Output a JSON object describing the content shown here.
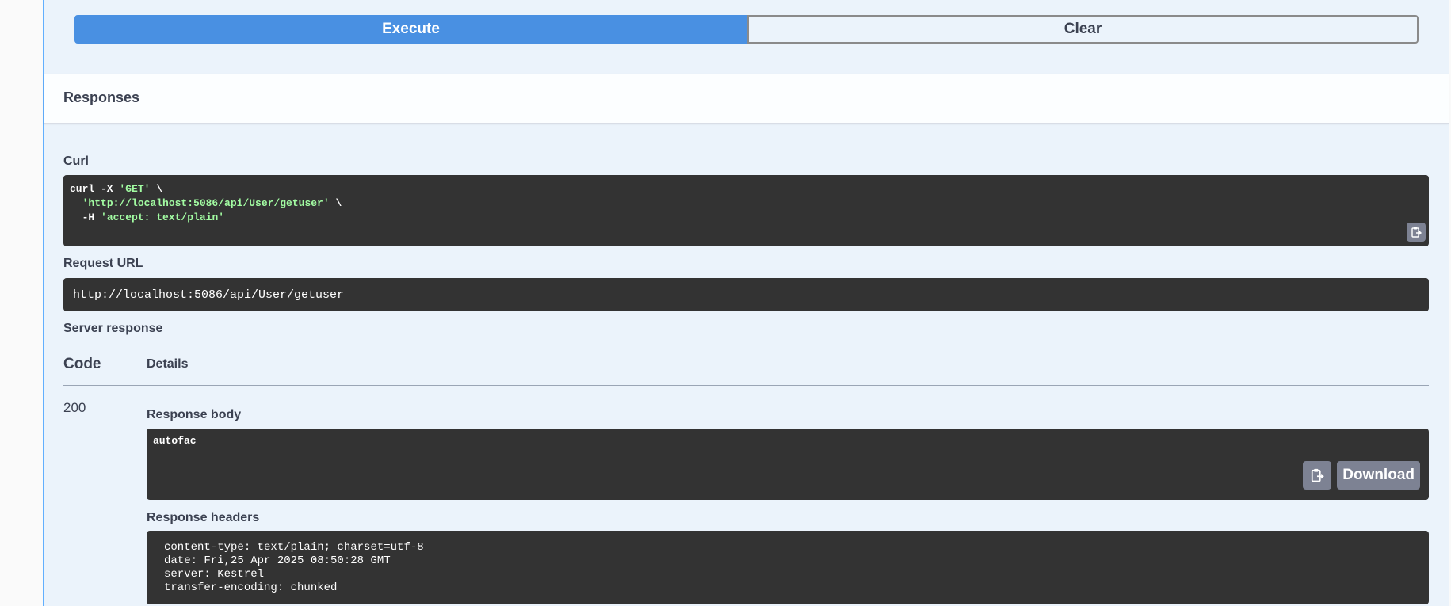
{
  "buttons": {
    "execute": "Execute",
    "clear": "Clear"
  },
  "responses": {
    "title": "Responses",
    "curl_label": "Curl",
    "curl": {
      "line1_cmd": "curl -X ",
      "line1_method": "'GET'",
      "line1_end": " \\",
      "line2_url": "'http://localhost:5086/api/User/getuser'",
      "line2_end": " \\",
      "line3_flag": "  -H ",
      "line3_header": "'accept: text/plain'"
    },
    "request_url_label": "Request URL",
    "request_url": "http://localhost:5086/api/User/getuser",
    "server_response_label": "Server response",
    "table": {
      "code_header": "Code",
      "details_header": "Details"
    },
    "status_code": "200",
    "response_body_label": "Response body",
    "response_body": "autofac",
    "download_label": "Download",
    "response_headers_label": "Response headers",
    "headers": [
      "content-type: text/plain; charset=utf-8",
      "date: Fri,25 Apr 2025 08:50:28 GMT",
      "server: Kestrel",
      "transfer-encoding: chunked"
    ]
  },
  "icons": {
    "copy": "clipboard-copy-icon"
  },
  "colors": {
    "execute_bg": "#4990e2",
    "panel_bg": "#ebf3fb",
    "code_bg": "#333333",
    "string_green": "#a2fca2",
    "copy_btn_bg": "#7d8293"
  }
}
